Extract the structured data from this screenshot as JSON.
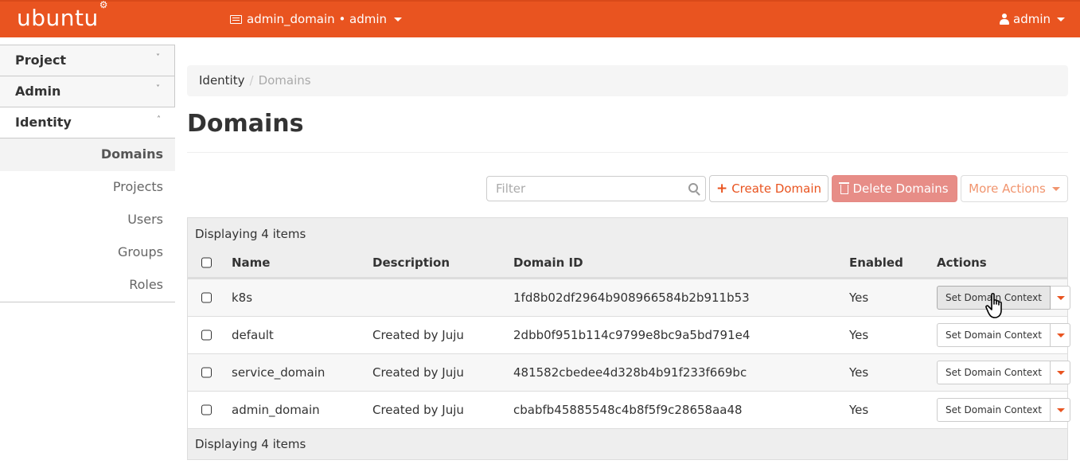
{
  "topbar": {
    "brand": "ubuntu",
    "brand_mark": "®",
    "project_switcher": "admin_domain • admin",
    "user_menu": "admin",
    "accent_color": "#e95420"
  },
  "sidebar": {
    "sections": [
      {
        "label": "Project",
        "chevron": "˅",
        "expanded": false
      },
      {
        "label": "Admin",
        "chevron": "˅",
        "expanded": false
      },
      {
        "label": "Identity",
        "chevron": "˄",
        "expanded": true
      }
    ],
    "identity_items": [
      {
        "label": "Domains",
        "active": true
      },
      {
        "label": "Projects",
        "active": false
      },
      {
        "label": "Users",
        "active": false
      },
      {
        "label": "Groups",
        "active": false
      },
      {
        "label": "Roles",
        "active": false
      }
    ]
  },
  "breadcrumb": {
    "parent": "Identity",
    "separator": "/",
    "current": "Domains"
  },
  "page": {
    "title": "Domains"
  },
  "toolbar": {
    "filter_placeholder": "Filter",
    "filter_value": "",
    "create_label": "Create Domain",
    "delete_label": "Delete Domains",
    "more_label": "More Actions"
  },
  "table": {
    "count_text": "Displaying 4 items",
    "columns": {
      "name": "Name",
      "description": "Description",
      "domain_id": "Domain ID",
      "enabled": "Enabled",
      "actions": "Actions"
    },
    "rows": [
      {
        "name": "k8s",
        "description": "",
        "domain_id": "1fd8b02df2964b908966584b2b911b53",
        "enabled": "Yes",
        "action": "Set Domain Context"
      },
      {
        "name": "default",
        "description": "Created by Juju",
        "domain_id": "2dbb0f951b114c9799e8bc9a5bd791e4",
        "enabled": "Yes",
        "action": "Set Domain Context"
      },
      {
        "name": "service_domain",
        "description": "Created by Juju",
        "domain_id": "481582cbedee4d328b4b91f233f669bc",
        "enabled": "Yes",
        "action": "Set Domain Context"
      },
      {
        "name": "admin_domain",
        "description": "Created by Juju",
        "domain_id": "cbabfb45885548c4b8f5f9c28658aa48",
        "enabled": "Yes",
        "action": "Set Domain Context"
      }
    ],
    "footer_text": "Displaying 4 items"
  }
}
